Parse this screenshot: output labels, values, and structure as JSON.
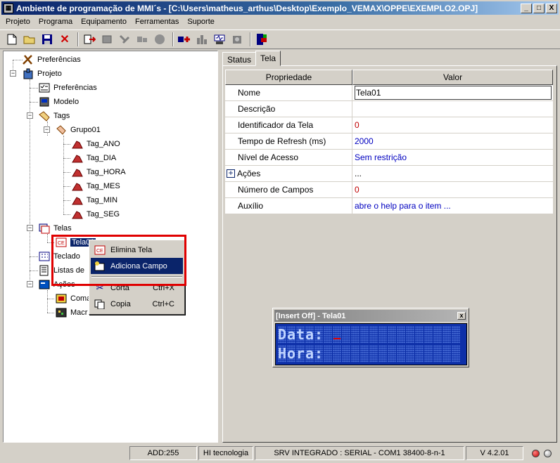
{
  "window": {
    "title": "Ambiente de programação de MMI´s - [C:\\Users\\matheus_arthus\\Desktop\\Exemplo_VEMAX\\OPPE\\EXEMPLO2.OPJ]",
    "btn_min": "_",
    "btn_max": "□",
    "btn_close": "X"
  },
  "menubar": [
    "Projeto",
    "Programa",
    "Equipamento",
    "Ferramentas",
    "Suporte"
  ],
  "toolbar_icons": [
    "new-file-icon",
    "open-folder-icon",
    "save-icon",
    "delete-icon",
    "transfer-icon",
    "send-icon",
    "connect-icon",
    "disconnect-icon",
    "add-icon",
    "plant-icon",
    "network-icon",
    "device-icon",
    "exit-icon"
  ],
  "tree": {
    "preferencias_root": "Preferências",
    "projeto": "Projeto",
    "preferencias": "Preferências",
    "modelo": "Modelo",
    "tags": "Tags",
    "grupo": "Grupo01",
    "tag_items": [
      "Tag_ANO",
      "Tag_DIA",
      "Tag_HORA",
      "Tag_MES",
      "Tag_MIN",
      "Tag_SEG"
    ],
    "telas": "Telas",
    "tela01": "Tela01",
    "teclado": "Teclado",
    "listas": "Listas de",
    "acoes": "Ações",
    "comandos": "Coma",
    "macros": "Macr"
  },
  "context_menu": {
    "items": [
      {
        "label": "Elimina Tela",
        "shortcut": ""
      },
      {
        "label": "Adiciona Campo",
        "shortcut": ""
      },
      {
        "label": "Corta",
        "shortcut": "Ctrl+X"
      },
      {
        "label": "Copia",
        "shortcut": "Ctrl+C"
      }
    ]
  },
  "tabs": [
    "Status",
    "Tela"
  ],
  "grid": {
    "col_prop": "Propriedade",
    "col_val": "Valor",
    "rows": [
      {
        "name": "Nome",
        "value": "Tela01"
      },
      {
        "name": "Descrição",
        "value": ""
      },
      {
        "name": "Identificador da Tela",
        "value": "0"
      },
      {
        "name": "Tempo de Refresh (ms)",
        "value": "2000"
      },
      {
        "name": "Nível de Acesso",
        "value": "Sem restrição"
      },
      {
        "name": "Ações",
        "value": "..."
      },
      {
        "name": "Número de Campos",
        "value": "0"
      },
      {
        "name": "Auxílio",
        "value": "abre o help para o item ..."
      }
    ],
    "plus": "+"
  },
  "lcd_window": {
    "title": "[Insert Off] - Tela01",
    "close": "x",
    "line1": "Data:",
    "line2": "Hora:"
  },
  "statusbar": {
    "add": "ADD:255",
    "company": "HI tecnologia",
    "connection": "SRV INTEGRADO : SERIAL - COM1 38400-8-n-1",
    "version": "V 4.2.01"
  },
  "colors": {
    "selection": "#0a246a",
    "highlight_box": "#e00000",
    "lcd_bg": "#0d2fa8"
  }
}
